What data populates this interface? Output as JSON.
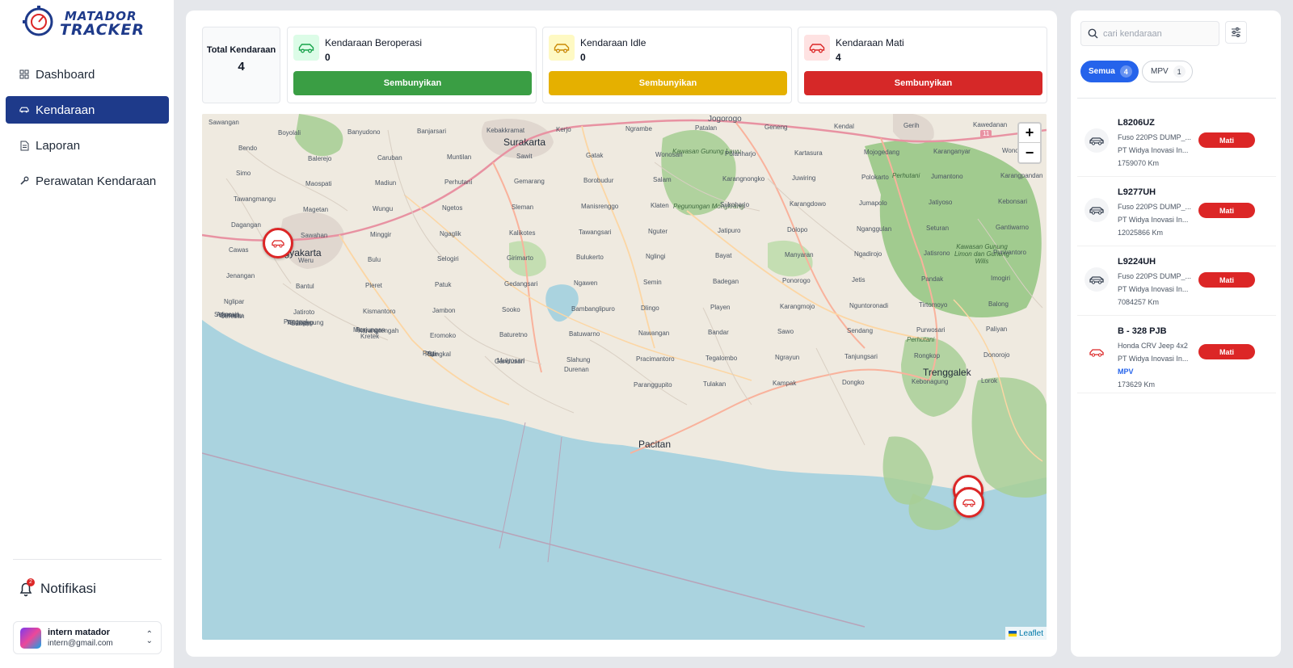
{
  "brand": {
    "line1": "MATADOR",
    "line2": "TRACKER"
  },
  "nav": [
    {
      "label": "Dashboard",
      "icon": "grid-icon"
    },
    {
      "label": "Kendaraan",
      "icon": "car-icon",
      "active": true
    },
    {
      "label": "Laporan",
      "icon": "document-icon"
    },
    {
      "label": "Perawatan Kendaraan",
      "icon": "wrench-icon"
    }
  ],
  "notifications": {
    "label": "Notifikasi",
    "badge": "2"
  },
  "user": {
    "name": "intern matador",
    "email": "intern@gmail.com"
  },
  "stats": {
    "total": {
      "label": "Total Kendaraan",
      "value": "4"
    },
    "operating": {
      "label": "Kendaraan Beroperasi",
      "value": "0",
      "button": "Sembunyikan",
      "color": "#3a9e44"
    },
    "idle": {
      "label": "Kendaraan Idle",
      "value": "0",
      "button": "Sembunyikan",
      "color": "#e5b000"
    },
    "off": {
      "label": "Kendaraan Mati",
      "value": "4",
      "button": "Sembunyikan",
      "color": "#d62828"
    }
  },
  "map": {
    "attribution": "Leaflet",
    "zoom_in": "+",
    "zoom_out": "−",
    "cities": [
      "Surakarta",
      "Yogyakarta",
      "Pacitan",
      "Trenggalek",
      "Jogorogo"
    ],
    "places": [
      "Sawangan",
      "Boyolali",
      "Banyudono",
      "Banjarsari",
      "Kebakkramat",
      "Kerjo",
      "Ngrambe",
      "Patalan",
      "Geneng",
      "Kendal",
      "Gerih",
      "Kawedanan",
      "Bendo",
      "Balerejo",
      "Caruban",
      "Muntilan",
      "Sawit",
      "Gatak",
      "Wonosari",
      "Polanharjo",
      "Kartasura",
      "Mojogedang",
      "Karanganyar",
      "Wonosalam",
      "Simo",
      "Maospati",
      "Madiun",
      "Perhutani",
      "Gemarang",
      "Borobudur",
      "Salam",
      "Karangnongko",
      "Juwiring",
      "Polokarto",
      "Jumantono",
      "Karangpandan",
      "Tawangmangu",
      "Magetan",
      "Wungu",
      "Ngetos",
      "Sleman",
      "Manisrenggo",
      "Klaten",
      "Sukoharjo",
      "Karangdowo",
      "Jumapolo",
      "Jatiyoso",
      "Kebonsari",
      "Dagangan",
      "Sawahan",
      "Minggir",
      "Ngaglik",
      "Kalikotes",
      "Tawangsari",
      "Nguter",
      "Jatipuro",
      "Dolopo",
      "Nganggulan",
      "Seturan",
      "Gantiwarno",
      "Cawas",
      "Weru",
      "Bulu",
      "Selogiri",
      "Girimarto",
      "Bulukerto",
      "Nglingi",
      "Bayat",
      "Manyaran",
      "Ngadirojo",
      "Jatisrono",
      "Purwantoro",
      "Jenangan",
      "Bantul",
      "Pleret",
      "Patuk",
      "Gedangsari",
      "Ngawen",
      "Semin",
      "Badegan",
      "Ponorogo",
      "Jetis",
      "Pandak",
      "Imogiri",
      "Nglipar",
      "Jatiroto",
      "Kismantoro",
      "Jambon",
      "Sooko",
      "Bambanglipuro",
      "Dlingo",
      "Playen",
      "Karangmojo",
      "Nguntoronadi",
      "Tirtomoyo",
      "Balong",
      "Joresan",
      "Sambit",
      "Kretek",
      "Eromoko",
      "Baturetno",
      "Batuwarno",
      "Nawangan",
      "Bandar",
      "Sawo",
      "Sendang",
      "Purwosari",
      "Paliyan",
      "Semanu",
      "Giriwoyo",
      "Karangtengah",
      "Bungkal",
      "Mulyosari",
      "Slahung",
      "Pracimantoro",
      "Tegalombo",
      "Ngrayun",
      "Tanjungsari",
      "Rongkop",
      "Donorojo",
      "Arjosari",
      "Tulungagung",
      "Punung",
      "Pule",
      "Gandusari",
      "Durenan",
      "Paranggupito",
      "Tulakan",
      "Kampak",
      "Dongko",
      "Kebonagung",
      "Lorok",
      "Sukorejo",
      "Panggul",
      "Munjungan",
      "Prigi"
    ],
    "forests": [
      "Kawasan Gunung Lawu",
      "Perhutani",
      "Pegunungan Mongkrang",
      "Kawasan Gunung Limon dan Gunung Wilis",
      "Perhutani"
    ],
    "road_label": "11"
  },
  "search": {
    "placeholder": "cari kendaraan"
  },
  "filters": [
    {
      "label": "Semua",
      "count": "4",
      "active": true
    },
    {
      "label": "MPV",
      "count": "1",
      "active": false
    }
  ],
  "vehicles": [
    {
      "plate": "L8206UZ",
      "model": "Fuso 220PS DUMP_...",
      "company": "PT Widya Inovasi In...",
      "type": "",
      "km": "1759070 Km",
      "status": "Mati"
    },
    {
      "plate": "L9277UH",
      "model": "Fuso 220PS DUMP_...",
      "company": "PT Widya Inovasi In...",
      "type": "",
      "km": "12025866 Km",
      "status": "Mati"
    },
    {
      "plate": "L9224UH",
      "model": "Fuso 220PS DUMP_...",
      "company": "PT Widya Inovasi In...",
      "type": "",
      "km": "7084257 Km",
      "status": "Mati"
    },
    {
      "plate": "B - 328 PJB",
      "model": "Honda CRV Jeep 4x2",
      "company": "PT Widya Inovasi In...",
      "type": "MPV",
      "km": "173629 Km",
      "status": "Mati"
    }
  ]
}
